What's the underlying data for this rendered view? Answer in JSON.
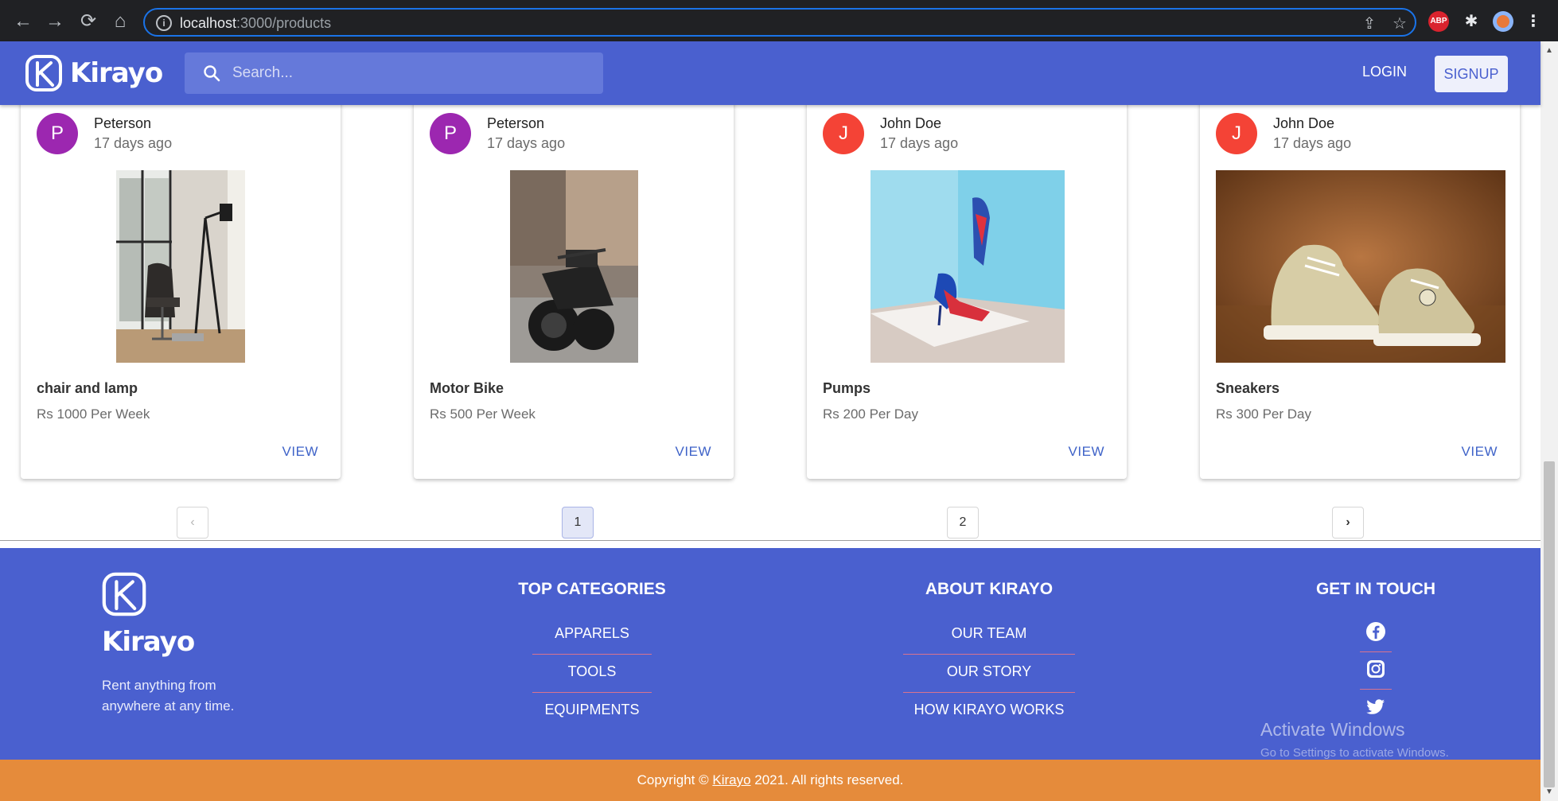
{
  "browser": {
    "url_host": "localhost",
    "url_rest": ":3000/products",
    "extensions": [
      "ABP"
    ]
  },
  "header": {
    "brand": "Kirayo",
    "search_placeholder": "Search...",
    "login": "LOGIN",
    "signup": "SIGNUP"
  },
  "products": [
    {
      "owner": "Peterson",
      "initial": "P",
      "avatar_color": "#9c27b0",
      "posted": "17 days ago",
      "name": "chair and lamp",
      "price": "Rs 1000 Per Week",
      "action": "VIEW"
    },
    {
      "owner": "Peterson",
      "initial": "P",
      "avatar_color": "#9c27b0",
      "posted": "17 days ago",
      "name": "Motor Bike",
      "price": "Rs 500 Per Week",
      "action": "VIEW"
    },
    {
      "owner": "John Doe",
      "initial": "J",
      "avatar_color": "#f44336",
      "posted": "17 days ago",
      "name": "Pumps",
      "price": "Rs 200 Per Day",
      "action": "VIEW"
    },
    {
      "owner": "John Doe",
      "initial": "J",
      "avatar_color": "#f44336",
      "posted": "17 days ago",
      "name": "Sneakers",
      "price": "Rs 300 Per Day",
      "action": "VIEW"
    }
  ],
  "pagination": {
    "prev": "‹",
    "pages": [
      "1",
      "2"
    ],
    "current": "1",
    "next": "›"
  },
  "footer": {
    "brand": "Kirayo",
    "tagline": "Rent anything from anywhere at any time.",
    "columns": [
      {
        "title": "TOP CATEGORIES",
        "links": [
          "APPARELS",
          "TOOLS",
          "EQUIPMENTS"
        ]
      },
      {
        "title": "ABOUT KIRAYO",
        "links": [
          "OUR TEAM",
          "OUR STORY",
          "HOW KIRAYO WORKS"
        ]
      },
      {
        "title": "GET IN TOUCH",
        "social": [
          "facebook-icon",
          "instagram-icon",
          "twitter-icon"
        ]
      }
    ],
    "copyright_before": "Copyright © ",
    "copyright_link": "Kirayo",
    "copyright_after": " 2021. All rights reserved."
  },
  "watermark": {
    "line1": "Activate Windows",
    "line2": "Go to Settings to activate Windows."
  },
  "colors": {
    "brand": "#4a60cf",
    "footer_bar": "#e58b3b",
    "accent_link": "#3f63c8"
  }
}
